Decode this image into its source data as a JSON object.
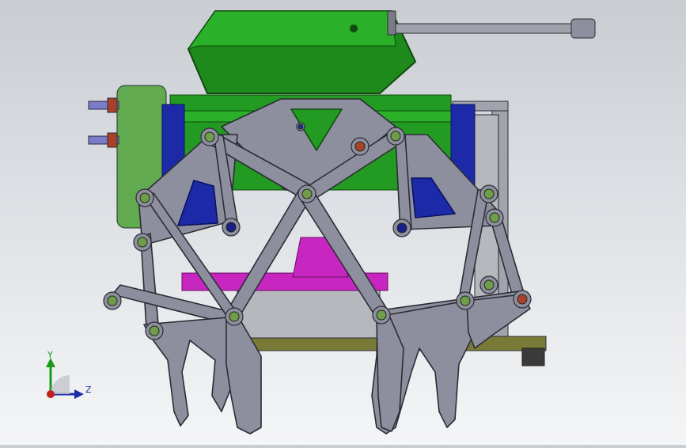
{
  "model": {
    "colors": {
      "background_top": "#c9cdd2",
      "background_bottom": "#f4f5f6",
      "leg_link": "#8e8f9e",
      "leg_link_stroke": "#2b2c35",
      "tank_body": "#239a22",
      "tank_turret": "#1e8a1c",
      "gun_barrel": "#9fa1ab",
      "blue_bracket": "#1d2aa8",
      "yellow_part": "#c9c21a",
      "magenta_part": "#c726c0",
      "base_plate": "#b7b8bd",
      "olive_plate": "#7a7a38",
      "side_panel": "#61aa4f",
      "bolt": "#6f9d4b",
      "bolt_red": "#a8402a",
      "pin_blue": "#1a1f8a"
    }
  },
  "triad": {
    "y_label": "Y",
    "z_label": "Z",
    "icon": "coordinate-triad-icon"
  }
}
